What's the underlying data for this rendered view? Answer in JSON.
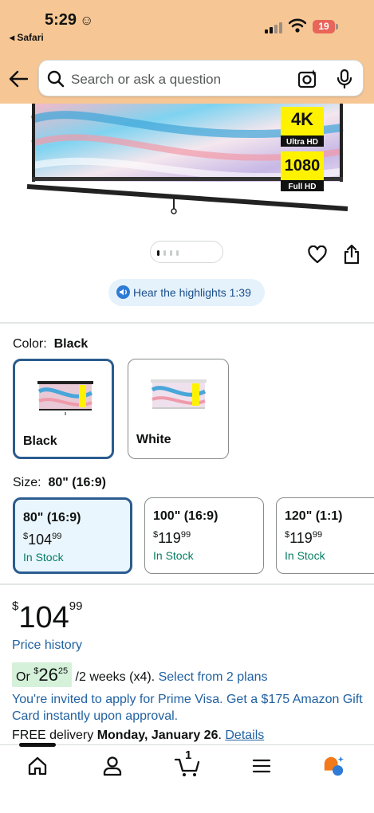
{
  "status_bar": {
    "time": "5:29",
    "back_app": "◂ Safari",
    "battery": "19"
  },
  "search": {
    "placeholder": "Search or ask a question"
  },
  "product_image": {
    "badge_4k": "4K",
    "badge_ultra_hd": "Ultra HD",
    "badge_1080": "1080",
    "badge_full_hd": "Full HD"
  },
  "audio": {
    "label": "Hear the highlights 1:39"
  },
  "color": {
    "label": "Color:",
    "selected": "Black",
    "options": [
      {
        "name": "Black"
      },
      {
        "name": "White"
      }
    ]
  },
  "size": {
    "label": "Size:",
    "selected": "80\" (16:9)",
    "options": [
      {
        "name": "80\" (16:9)",
        "currency": "$",
        "whole": "104",
        "cents": "99",
        "stock": "In Stock"
      },
      {
        "name": "100\" (16:9)",
        "currency": "$",
        "whole": "119",
        "cents": "99",
        "stock": "In Stock"
      },
      {
        "name": "120\" (1:1)",
        "currency": "$",
        "whole": "119",
        "cents": "99",
        "stock": "In Stock"
      }
    ]
  },
  "price": {
    "currency": "$",
    "whole": "104",
    "cents": "99"
  },
  "price_history": "Price history",
  "installments": {
    "prefix": "Or ",
    "currency": "$",
    "whole": "26",
    "cents": "25",
    "suffix": " /2 weeks (x4). ",
    "link": "Select from 2 plans"
  },
  "prime_offer": "You're invited to apply for Prime Visa. Get a $175 Amazon Gift Card instantly upon approval.",
  "delivery": {
    "prefix": "FREE delivery ",
    "date": "Monday, January 26",
    "sep": ". ",
    "link": "Details"
  },
  "cart_count": "1",
  "colors": {
    "header": "#F6C795",
    "link": "#2162A1",
    "in_stock": "#067D62",
    "selected_border": "#2A5C8F",
    "install_bg": "#D5F1DA"
  },
  "icons": [
    "back-arrow-icon",
    "search-icon",
    "camera-icon",
    "mic-icon",
    "heart-icon",
    "share-icon",
    "speaker-icon",
    "home-icon",
    "account-icon",
    "cart-icon",
    "menu-icon",
    "rufus-icon"
  ]
}
